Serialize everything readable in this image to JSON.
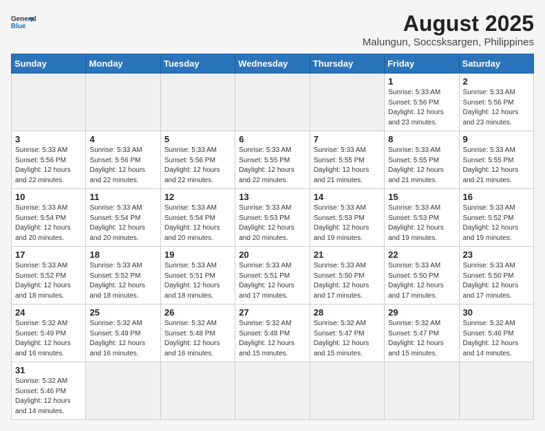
{
  "header": {
    "logo_general": "General",
    "logo_blue": "Blue",
    "month_year": "August 2025",
    "location": "Malungun, Soccsksargen, Philippines"
  },
  "days_of_week": [
    "Sunday",
    "Monday",
    "Tuesday",
    "Wednesday",
    "Thursday",
    "Friday",
    "Saturday"
  ],
  "weeks": [
    [
      {
        "day": "",
        "empty": true
      },
      {
        "day": "",
        "empty": true
      },
      {
        "day": "",
        "empty": true
      },
      {
        "day": "",
        "empty": true
      },
      {
        "day": "",
        "empty": true
      },
      {
        "day": "1",
        "info": "Sunrise: 5:33 AM\nSunset: 5:56 PM\nDaylight: 12 hours\nand 23 minutes."
      },
      {
        "day": "2",
        "info": "Sunrise: 5:33 AM\nSunset: 5:56 PM\nDaylight: 12 hours\nand 23 minutes."
      }
    ],
    [
      {
        "day": "3",
        "info": "Sunrise: 5:33 AM\nSunset: 5:56 PM\nDaylight: 12 hours\nand 22 minutes."
      },
      {
        "day": "4",
        "info": "Sunrise: 5:33 AM\nSunset: 5:56 PM\nDaylight: 12 hours\nand 22 minutes."
      },
      {
        "day": "5",
        "info": "Sunrise: 5:33 AM\nSunset: 5:56 PM\nDaylight: 12 hours\nand 22 minutes."
      },
      {
        "day": "6",
        "info": "Sunrise: 5:33 AM\nSunset: 5:55 PM\nDaylight: 12 hours\nand 22 minutes."
      },
      {
        "day": "7",
        "info": "Sunrise: 5:33 AM\nSunset: 5:55 PM\nDaylight: 12 hours\nand 21 minutes."
      },
      {
        "day": "8",
        "info": "Sunrise: 5:33 AM\nSunset: 5:55 PM\nDaylight: 12 hours\nand 21 minutes."
      },
      {
        "day": "9",
        "info": "Sunrise: 5:33 AM\nSunset: 5:55 PM\nDaylight: 12 hours\nand 21 minutes."
      }
    ],
    [
      {
        "day": "10",
        "info": "Sunrise: 5:33 AM\nSunset: 5:54 PM\nDaylight: 12 hours\nand 20 minutes."
      },
      {
        "day": "11",
        "info": "Sunrise: 5:33 AM\nSunset: 5:54 PM\nDaylight: 12 hours\nand 20 minutes."
      },
      {
        "day": "12",
        "info": "Sunrise: 5:33 AM\nSunset: 5:54 PM\nDaylight: 12 hours\nand 20 minutes."
      },
      {
        "day": "13",
        "info": "Sunrise: 5:33 AM\nSunset: 5:53 PM\nDaylight: 12 hours\nand 20 minutes."
      },
      {
        "day": "14",
        "info": "Sunrise: 5:33 AM\nSunset: 5:53 PM\nDaylight: 12 hours\nand 19 minutes."
      },
      {
        "day": "15",
        "info": "Sunrise: 5:33 AM\nSunset: 5:53 PM\nDaylight: 12 hours\nand 19 minutes."
      },
      {
        "day": "16",
        "info": "Sunrise: 5:33 AM\nSunset: 5:52 PM\nDaylight: 12 hours\nand 19 minutes."
      }
    ],
    [
      {
        "day": "17",
        "info": "Sunrise: 5:33 AM\nSunset: 5:52 PM\nDaylight: 12 hours\nand 18 minutes."
      },
      {
        "day": "18",
        "info": "Sunrise: 5:33 AM\nSunset: 5:52 PM\nDaylight: 12 hours\nand 18 minutes."
      },
      {
        "day": "19",
        "info": "Sunrise: 5:33 AM\nSunset: 5:51 PM\nDaylight: 12 hours\nand 18 minutes."
      },
      {
        "day": "20",
        "info": "Sunrise: 5:33 AM\nSunset: 5:51 PM\nDaylight: 12 hours\nand 17 minutes."
      },
      {
        "day": "21",
        "info": "Sunrise: 5:33 AM\nSunset: 5:50 PM\nDaylight: 12 hours\nand 17 minutes."
      },
      {
        "day": "22",
        "info": "Sunrise: 5:33 AM\nSunset: 5:50 PM\nDaylight: 12 hours\nand 17 minutes."
      },
      {
        "day": "23",
        "info": "Sunrise: 5:33 AM\nSunset: 5:50 PM\nDaylight: 12 hours\nand 17 minutes."
      }
    ],
    [
      {
        "day": "24",
        "info": "Sunrise: 5:32 AM\nSunset: 5:49 PM\nDaylight: 12 hours\nand 16 minutes."
      },
      {
        "day": "25",
        "info": "Sunrise: 5:32 AM\nSunset: 5:49 PM\nDaylight: 12 hours\nand 16 minutes."
      },
      {
        "day": "26",
        "info": "Sunrise: 5:32 AM\nSunset: 5:48 PM\nDaylight: 12 hours\nand 16 minutes."
      },
      {
        "day": "27",
        "info": "Sunrise: 5:32 AM\nSunset: 5:48 PM\nDaylight: 12 hours\nand 15 minutes."
      },
      {
        "day": "28",
        "info": "Sunrise: 5:32 AM\nSunset: 5:47 PM\nDaylight: 12 hours\nand 15 minutes."
      },
      {
        "day": "29",
        "info": "Sunrise: 5:32 AM\nSunset: 5:47 PM\nDaylight: 12 hours\nand 15 minutes."
      },
      {
        "day": "30",
        "info": "Sunrise: 5:32 AM\nSunset: 5:46 PM\nDaylight: 12 hours\nand 14 minutes."
      }
    ],
    [
      {
        "day": "31",
        "info": "Sunrise: 5:32 AM\nSunset: 5:46 PM\nDaylight: 12 hours\nand 14 minutes."
      },
      {
        "day": "",
        "empty": true
      },
      {
        "day": "",
        "empty": true
      },
      {
        "day": "",
        "empty": true
      },
      {
        "day": "",
        "empty": true
      },
      {
        "day": "",
        "empty": true
      },
      {
        "day": "",
        "empty": true
      }
    ]
  ]
}
